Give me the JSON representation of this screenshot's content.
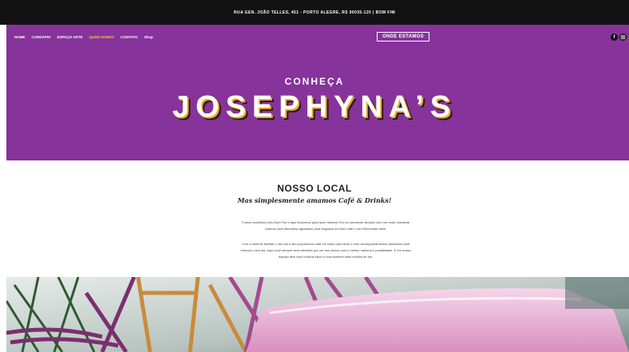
{
  "topbar": {
    "address": "RUA GEN. JOÃO TELLES, 451 - PORTO ALEGRE, RS 90035-120  |  BOM FIM"
  },
  "nav": {
    "items": [
      "HOME",
      "CARDÁPIO",
      "ESPAÇO ARTE",
      "QUEM SOMOS",
      "CONTATO",
      "Shop"
    ],
    "active": "QUEM SOMOS"
  },
  "header": {
    "cta_label": "ONDE ESTAMOS"
  },
  "hero": {
    "kicker": "CONHEÇA",
    "brand": "JOSEPHYNA’S"
  },
  "about": {
    "title": "NOSSO LOCAL",
    "subtitle": "Mas simplesmente amamos Café & Drinks!",
    "paragraph1": "Fomos acolhidos pelo Bom Fim e aqui ficaremos para fazer história. Em um ambiente simples com um estilo industrial criamos uma atmosfera agradável para degustar um bom café e um refrescante drink.",
    "paragraph2": "Com a ideia de facilitar o seu dia a dia propusemos café em estilo para levar e com acompanhamentos deliciosos para reforçar o seu dia. Aqui você sempre será atendido por um dos sócios com o melhor carisma e positividade. E em nosso espaço arte você poderá expor a sua maneira mais criativa de ser."
  },
  "colors": {
    "hero_bg": "#86339b",
    "topbar_bg": "#121212",
    "brand_shadow": "#e9a82c"
  },
  "icons": [
    "facebook-icon",
    "instagram-icon"
  ]
}
